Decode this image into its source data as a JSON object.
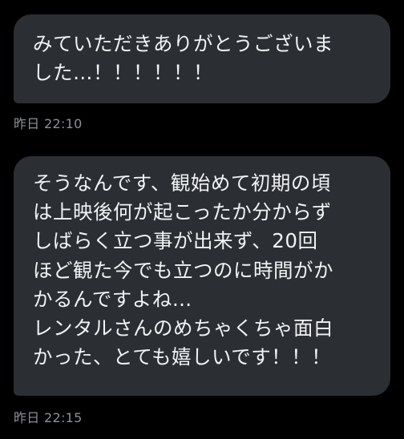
{
  "messages": [
    {
      "lines": [
        "みていただきありがとうございま",
        "した…！！！！！！"
      ],
      "timestamp": "昨日 22:10"
    },
    {
      "lines": [
        "そうなんです、観始めて初期の頃",
        "は上映後何が起こったか分からず",
        "しばらく立つ事が出来ず、20回",
        "ほど観た今でも立つのに時間がか",
        "かるんですよね…",
        "レンタルさんのめちゃくちゃ面白",
        "かった、とても嬉しいです！！！"
      ],
      "timestamp": "昨日 22:15"
    }
  ],
  "colors": {
    "background": "#000000",
    "bubble": "#2b2f33",
    "text": "#f1f3f5",
    "timestamp": "#8b9197"
  }
}
